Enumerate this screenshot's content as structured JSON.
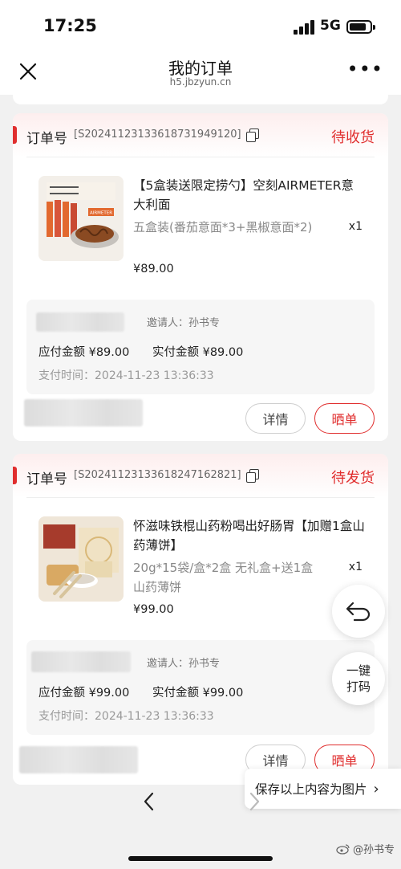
{
  "status_bar": {
    "time": "17:25",
    "network": "5G"
  },
  "nav": {
    "title": "我的订单",
    "url": "h5.jbzyun.cn",
    "more": "•••"
  },
  "orders": [
    {
      "order_label": "订单号",
      "order_number": "[S20241123133618731949120]",
      "status": "待收货",
      "product_title": "【5盒装送限定捞勺】空刻AIRMETER意大利面",
      "product_spec": "五盒装(番茄意面*3+黑椒意面*2)",
      "quantity": "x1",
      "price": "¥89.00",
      "thumb_tag": "AIRMETER",
      "inviter": "邀请人：孙书专",
      "amount_due": "应付金额 ¥89.00",
      "amount_paid": "实付金额 ¥89.00",
      "pay_time": "支付时间：2024-11-23 13:36:33",
      "detail_button": "详情",
      "share_button": "晒单"
    },
    {
      "order_label": "订单号",
      "order_number": "[S20241123133618247162821]",
      "status": "待发货",
      "product_title": "怀滋味铁棍山药粉喝出好肠胃【加赠1盒山药薄饼】",
      "product_spec": "20g*15袋/盒*2盒 无礼盒+送1盒山药薄饼",
      "quantity": "x1",
      "price": "¥99.00",
      "inviter": "邀请人：孙书专",
      "amount_due": "应付金额 ¥99.00",
      "amount_paid": "实付金额 ¥99.00",
      "pay_time": "支付时间：2024-11-23 13:36:33",
      "detail_button": "详情",
      "share_button": "晒单"
    }
  ],
  "floating": {
    "back_icon": "undo-arrow-icon",
    "print_label": "一键打码"
  },
  "save_bar": {
    "label": "保存以上内容为图片",
    "chevron": "›"
  },
  "watermark": {
    "text": "@孙书专"
  }
}
